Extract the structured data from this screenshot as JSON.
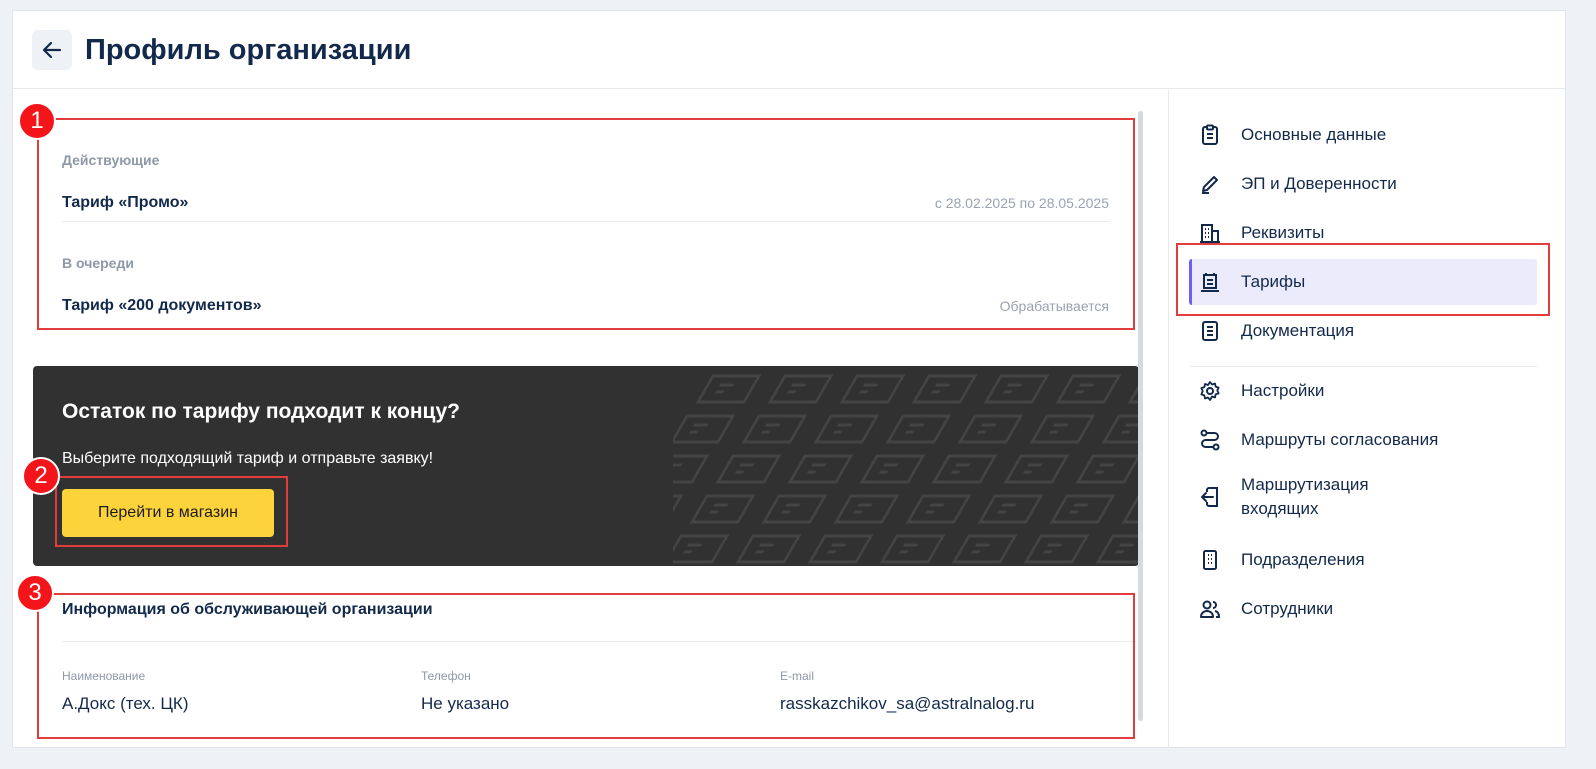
{
  "header": {
    "title": "Профиль организации"
  },
  "tariffs": {
    "active": {
      "section_label": "Действующие",
      "name": "Тариф «Промо»",
      "period": "с 28.02.2025 по 28.05.2025"
    },
    "queued": {
      "section_label": "В очереди",
      "name": "Тариф «200 документов»",
      "status": "Обрабатывается"
    }
  },
  "promo": {
    "title": "Остаток по тарифу подходит к концу?",
    "text": "Выберите подходящий тариф и отправьте заявку!",
    "button_label": "Перейти в магазин"
  },
  "service_org": {
    "title": "Информация об обслуживающей организации",
    "fields": [
      {
        "label": "Наименование",
        "value": "А.Докс (тех. ЦК)"
      },
      {
        "label": "Телефон",
        "value": "Не указано"
      },
      {
        "label": "E-mail",
        "value": "rasskazchikov_sa@astralnalog.ru"
      }
    ]
  },
  "sidebar": {
    "items": [
      {
        "label": "Основные данные",
        "icon": "clipboard-icon"
      },
      {
        "label": "ЭП и Доверенности",
        "icon": "pen-icon"
      },
      {
        "label": "Реквизиты",
        "icon": "building-icon"
      },
      {
        "label": "Тарифы",
        "icon": "tariff-icon",
        "active": true
      },
      {
        "label": "Документация",
        "icon": "document-icon"
      },
      {
        "label": "Настройки",
        "icon": "gear-icon"
      },
      {
        "label": "Маршруты согласования",
        "icon": "route-icon"
      },
      {
        "label": "Маршрутизация входящих",
        "icon": "incoming-icon"
      },
      {
        "label": "Подразделения",
        "icon": "office-icon"
      },
      {
        "label": "Сотрудники",
        "icon": "users-icon"
      }
    ]
  },
  "annotations": {
    "markers": [
      "1",
      "2",
      "3"
    ]
  },
  "colors": {
    "accent": "#6f5ef0",
    "button": "#fdd33b",
    "highlight": "#e23c3c",
    "marker": "#f4151b",
    "promo_bg": "#313131",
    "text": "#13294b"
  }
}
